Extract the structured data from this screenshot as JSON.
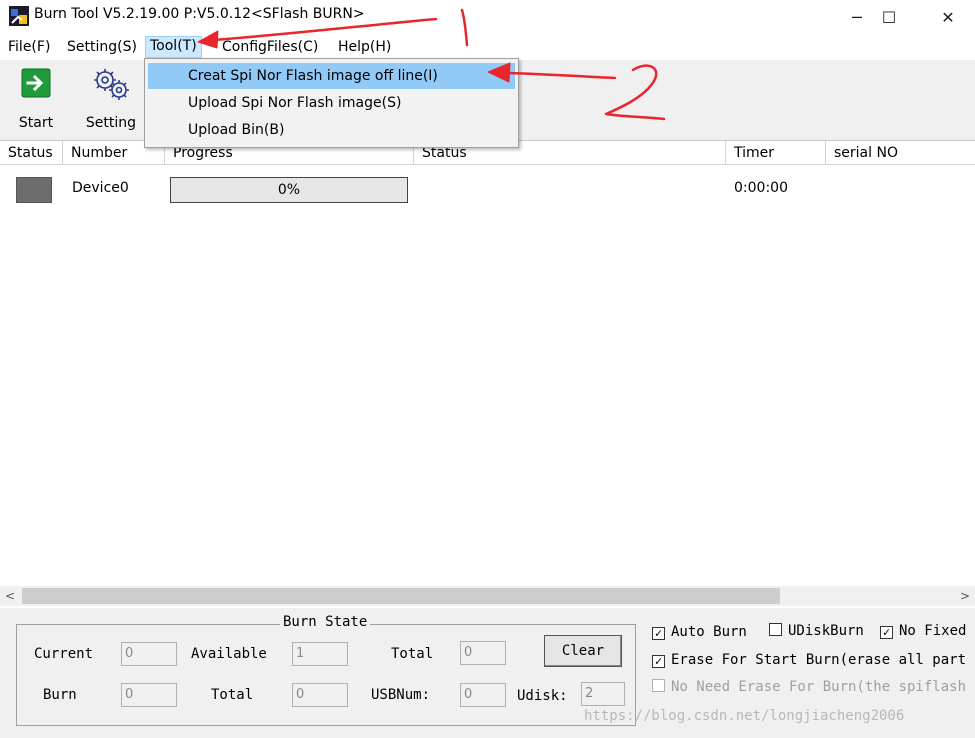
{
  "window": {
    "title": "Burn Tool V5.2.19.00 P:V5.0.12<SFlash BURN>",
    "min": "─",
    "max": "☐",
    "close": "✕"
  },
  "menu": {
    "file": "File(F)",
    "setting": "Setting(S)",
    "tool": "Tool(T)",
    "configfiles": "ConfigFiles(C)",
    "help": "Help(H)"
  },
  "toolbar": {
    "start": "Start",
    "setting": "Setting"
  },
  "tool_menu": [
    "Creat Spi Nor Flash image off line(I)",
    "Upload Spi Nor Flash image(S)",
    "Upload Bin(B)"
  ],
  "table": {
    "headers": [
      "Status",
      "Number",
      "Progress",
      "Status",
      "Timer",
      "serial NO"
    ],
    "rows": [
      {
        "number": "Device0",
        "progress": "0%",
        "timer": "0:00:00"
      }
    ]
  },
  "burn_state": {
    "title": "Burn State",
    "current_label": "Current",
    "current": "0",
    "available_label": "Available",
    "available": "1",
    "total_label": "Total",
    "total": "0",
    "burn_label": "Burn",
    "burn": "0",
    "total2_label": "Total",
    "total2": "0",
    "usbnum_label": "USBNum:",
    "usbnum": "0",
    "udisk_label": "Udisk:",
    "udisk": "2",
    "clear": "Clear"
  },
  "options": {
    "auto_burn": "Auto Burn",
    "udisk_burn": "UDiskBurn",
    "no_fixed": "No Fixed",
    "erase": "Erase For Start Burn(erase all part",
    "no_need_erase": "No Need Erase For Burn(the spiflash"
  },
  "annotations": {
    "one": "1",
    "two": "2"
  },
  "watermark": "https://blog.csdn.net/longjiacheng2006",
  "colors": {
    "highlight": "#91c9f7",
    "annotation": "#e8262b",
    "start_icon": "#1e9c3c"
  }
}
